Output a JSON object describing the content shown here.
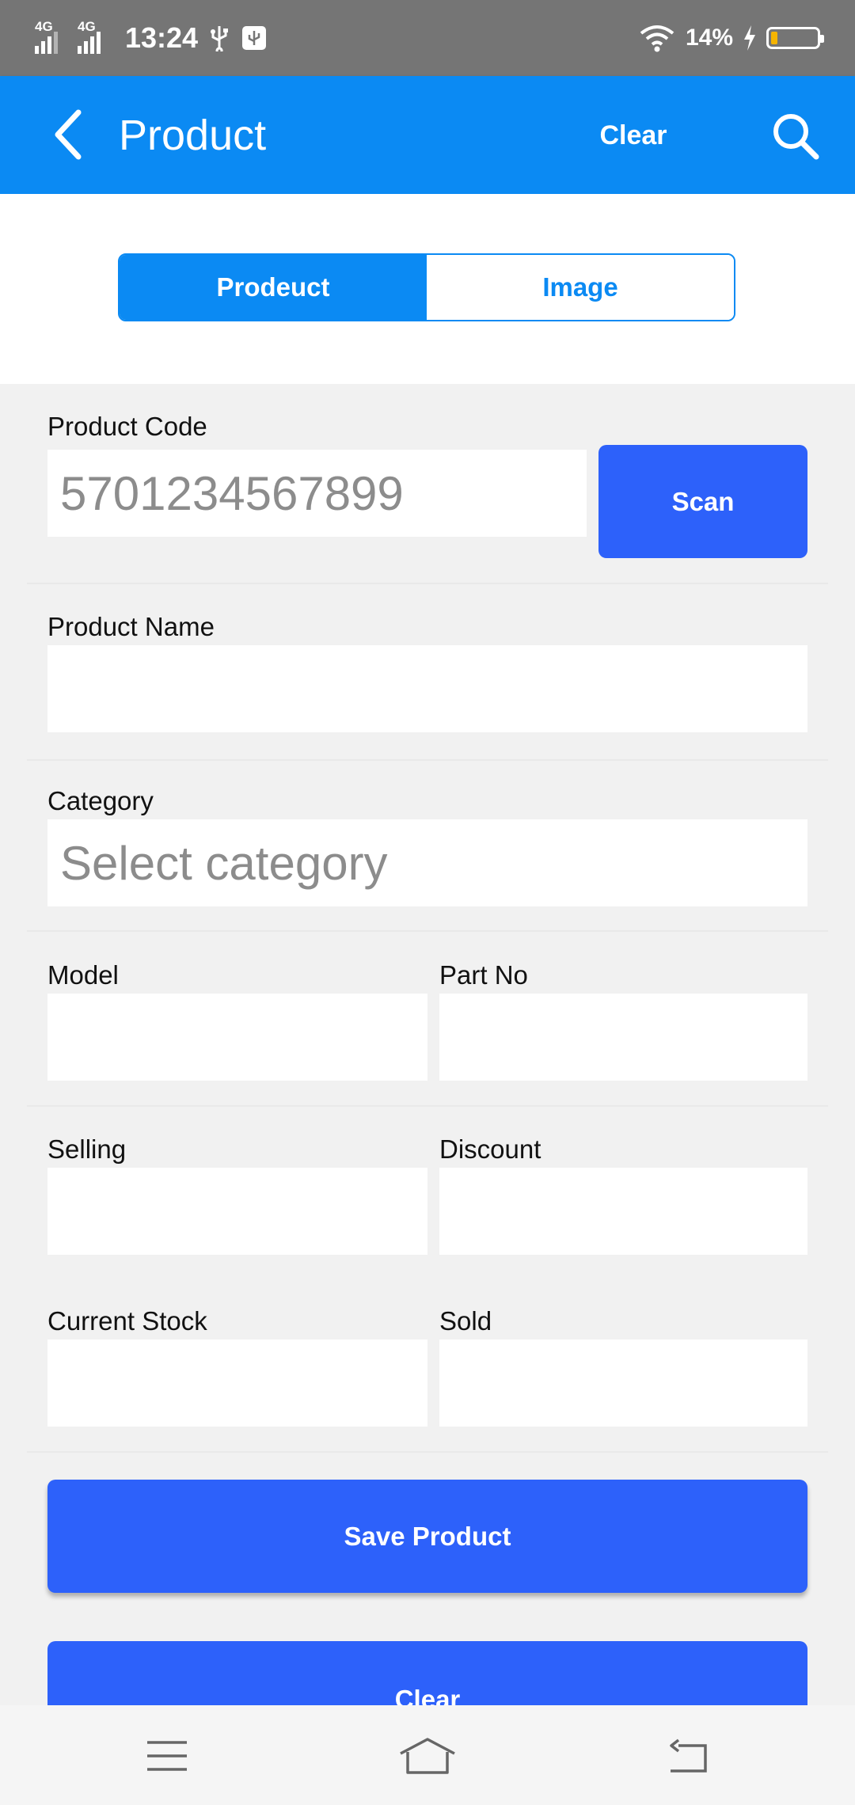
{
  "status_bar": {
    "network_1": "4G",
    "network_2": "4G",
    "time": "13:24",
    "battery_percent": "14%",
    "battery_level": 0.14,
    "icons": [
      "usb-icon",
      "usb-debug-icon",
      "wifi-icon",
      "charging-icon",
      "battery-icon"
    ]
  },
  "app_bar": {
    "title": "Product",
    "clear_label": "Clear",
    "back_icon": "back-arrow-icon",
    "search_icon": "search-icon"
  },
  "tabs": [
    {
      "label": "Prodeuct",
      "active": true
    },
    {
      "label": "Image",
      "active": false
    }
  ],
  "form": {
    "product_code": {
      "label": "Product Code",
      "placeholder": "5701234567899",
      "value": ""
    },
    "scan_label": "Scan",
    "product_name": {
      "label": "Product Name",
      "value": ""
    },
    "category": {
      "label": "Category",
      "placeholder": "Select category",
      "value": ""
    },
    "model": {
      "label": "Model",
      "value": ""
    },
    "part_no": {
      "label": "Part No",
      "value": ""
    },
    "selling": {
      "label": "Selling",
      "value": ""
    },
    "discount": {
      "label": "Discount",
      "value": ""
    },
    "current_stock": {
      "label": "Current Stock",
      "value": ""
    },
    "sold": {
      "label": "Sold",
      "value": ""
    },
    "save_label": "Save Product",
    "clear_label": "Clear"
  },
  "nav_bar": {
    "icons": [
      "menu-icon",
      "home-icon",
      "back-icon"
    ]
  },
  "colors": {
    "app_bar": "#0b8af3",
    "status_bar": "#757575",
    "primary_button": "#2d61fa",
    "background": "#f1f1f1",
    "battery_fill": "#f5b400"
  }
}
